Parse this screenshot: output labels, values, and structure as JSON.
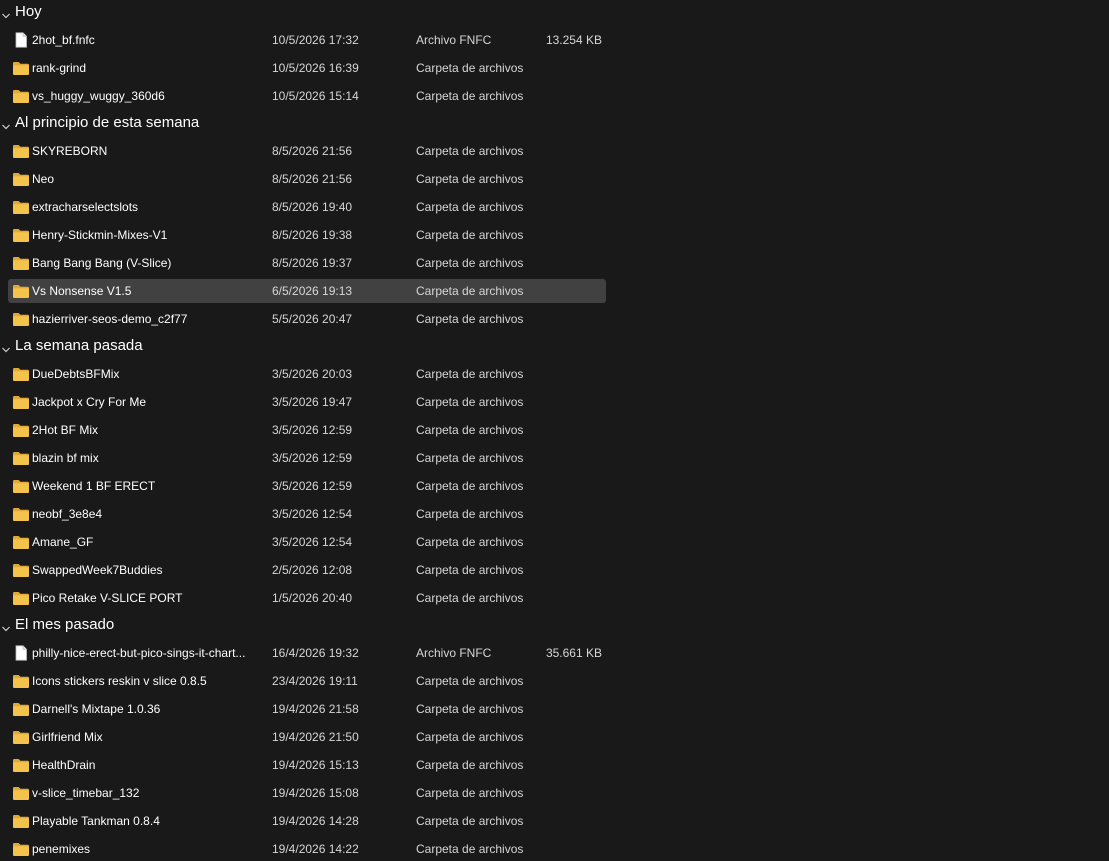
{
  "colors": {
    "background": "#191919",
    "selected_row": "#414141",
    "folder": "#f4c34b",
    "text": "#ffffff",
    "subtext": "#d6d6d6"
  },
  "icons": {
    "folder": "folder-icon",
    "file": "file-icon",
    "group_toggle": "chevron-down-icon"
  },
  "groups": [
    {
      "title": "Hoy",
      "items": [
        {
          "name": "2hot_bf.fnfc",
          "date": "10/5/2026 17:32",
          "type": "Archivo FNFC",
          "size": "13.254 KB",
          "kind": "file"
        },
        {
          "name": "rank-grind",
          "date": "10/5/2026 16:39",
          "type": "Carpeta de archivos",
          "size": "",
          "kind": "folder"
        },
        {
          "name": "vs_huggy_wuggy_360d6",
          "date": "10/5/2026 15:14",
          "type": "Carpeta de archivos",
          "size": "",
          "kind": "folder"
        }
      ]
    },
    {
      "title": "Al principio de esta semana",
      "items": [
        {
          "name": "SKYREBORN",
          "date": "8/5/2026 21:56",
          "type": "Carpeta de archivos",
          "size": "",
          "kind": "folder"
        },
        {
          "name": "Neo",
          "date": "8/5/2026 21:56",
          "type": "Carpeta de archivos",
          "size": "",
          "kind": "folder"
        },
        {
          "name": "extracharselectslots",
          "date": "8/5/2026 19:40",
          "type": "Carpeta de archivos",
          "size": "",
          "kind": "folder"
        },
        {
          "name": "Henry-Stickmin-Mixes-V1",
          "date": "8/5/2026 19:38",
          "type": "Carpeta de archivos",
          "size": "",
          "kind": "folder"
        },
        {
          "name": "Bang Bang Bang (V-Slice)",
          "date": "8/5/2026 19:37",
          "type": "Carpeta de archivos",
          "size": "",
          "kind": "folder"
        },
        {
          "name": "Vs Nonsense V1.5",
          "date": "6/5/2026 19:13",
          "type": "Carpeta de archivos",
          "size": "",
          "kind": "folder",
          "selected": true
        },
        {
          "name": "hazierriver-seos-demo_c2f77",
          "date": "5/5/2026 20:47",
          "type": "Carpeta de archivos",
          "size": "",
          "kind": "folder"
        }
      ]
    },
    {
      "title": "La semana pasada",
      "items": [
        {
          "name": "DueDebtsBFMix",
          "date": "3/5/2026 20:03",
          "type": "Carpeta de archivos",
          "size": "",
          "kind": "folder"
        },
        {
          "name": "Jackpot x Cry For Me",
          "date": "3/5/2026 19:47",
          "type": "Carpeta de archivos",
          "size": "",
          "kind": "folder"
        },
        {
          "name": "2Hot BF Mix",
          "date": "3/5/2026 12:59",
          "type": "Carpeta de archivos",
          "size": "",
          "kind": "folder"
        },
        {
          "name": "blazin bf mix",
          "date": "3/5/2026 12:59",
          "type": "Carpeta de archivos",
          "size": "",
          "kind": "folder"
        },
        {
          "name": "Weekend 1 BF ERECT",
          "date": "3/5/2026 12:59",
          "type": "Carpeta de archivos",
          "size": "",
          "kind": "folder"
        },
        {
          "name": "neobf_3e8e4",
          "date": "3/5/2026 12:54",
          "type": "Carpeta de archivos",
          "size": "",
          "kind": "folder"
        },
        {
          "name": "Amane_GF",
          "date": "3/5/2026 12:54",
          "type": "Carpeta de archivos",
          "size": "",
          "kind": "folder"
        },
        {
          "name": "SwappedWeek7Buddies",
          "date": "2/5/2026 12:08",
          "type": "Carpeta de archivos",
          "size": "",
          "kind": "folder"
        },
        {
          "name": "Pico Retake V-SLICE PORT",
          "date": "1/5/2026 20:40",
          "type": "Carpeta de archivos",
          "size": "",
          "kind": "folder"
        }
      ]
    },
    {
      "title": "El mes pasado",
      "items": [
        {
          "name": "philly-nice-erect-but-pico-sings-it-chart...",
          "date": "16/4/2026 19:32",
          "type": "Archivo FNFC",
          "size": "35.661 KB",
          "kind": "file"
        },
        {
          "name": "Icons stickers reskin v slice 0.8.5",
          "date": "23/4/2026 19:11",
          "type": "Carpeta de archivos",
          "size": "",
          "kind": "folder"
        },
        {
          "name": "Darnell's Mixtape 1.0.36",
          "date": "19/4/2026 21:58",
          "type": "Carpeta de archivos",
          "size": "",
          "kind": "folder"
        },
        {
          "name": "Girlfriend Mix",
          "date": "19/4/2026 21:50",
          "type": "Carpeta de archivos",
          "size": "",
          "kind": "folder"
        },
        {
          "name": "HealthDrain",
          "date": "19/4/2026 15:13",
          "type": "Carpeta de archivos",
          "size": "",
          "kind": "folder"
        },
        {
          "name": "v-slice_timebar_132",
          "date": "19/4/2026 15:08",
          "type": "Carpeta de archivos",
          "size": "",
          "kind": "folder"
        },
        {
          "name": "Playable Tankman 0.8.4",
          "date": "19/4/2026 14:28",
          "type": "Carpeta de archivos",
          "size": "",
          "kind": "folder"
        },
        {
          "name": "penemixes",
          "date": "19/4/2026 14:22",
          "type": "Carpeta de archivos",
          "size": "",
          "kind": "folder"
        }
      ]
    }
  ]
}
